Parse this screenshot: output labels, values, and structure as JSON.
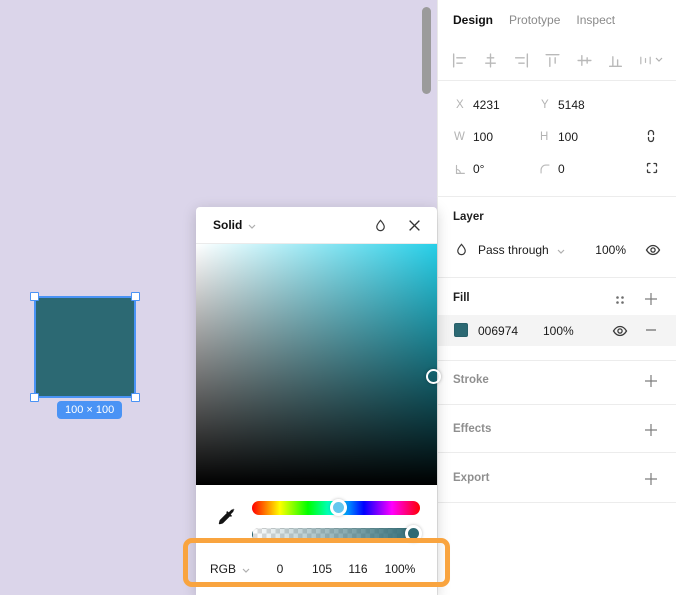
{
  "canvas": {
    "size_badge": "100 × 100"
  },
  "picker": {
    "title": "Solid",
    "mode": "RGB",
    "r": "0",
    "g": "105",
    "b": "116",
    "a": "100%"
  },
  "panel": {
    "tabs": {
      "design": "Design",
      "prototype": "Prototype",
      "inspect": "Inspect"
    },
    "position": {
      "x_label": "X",
      "x_value": "4231",
      "y_label": "Y",
      "y_value": "5148",
      "w_label": "W",
      "w_value": "100",
      "h_label": "H",
      "h_value": "100",
      "rotation_value": "0°",
      "radius_value": "0"
    },
    "layer": {
      "title": "Layer",
      "blend_mode": "Pass through",
      "opacity": "100%"
    },
    "fill": {
      "title": "Fill",
      "hex": "006974",
      "opacity": "100%"
    },
    "stroke_title": "Stroke",
    "effects_title": "Effects",
    "export_title": "Export"
  },
  "colors": {
    "fill_hex": "#006974",
    "rendered_teal": "#2C6973",
    "selection_blue": "#4A93F5",
    "canvas_background": "#DBD5EA",
    "annotation_orange": "#F9A43F"
  },
  "icons": {
    "align": [
      "align-left",
      "align-horizontal-center",
      "align-right",
      "align-top",
      "align-vertical-center",
      "align-bottom",
      "distribute-spacing"
    ],
    "misc": [
      "constrain-proportions",
      "frame-corners",
      "rotation-angle",
      "corner-radius",
      "blend-droplet",
      "eye",
      "styles-dots",
      "plus",
      "minus",
      "close",
      "eyedropper",
      "chevron-down"
    ]
  }
}
